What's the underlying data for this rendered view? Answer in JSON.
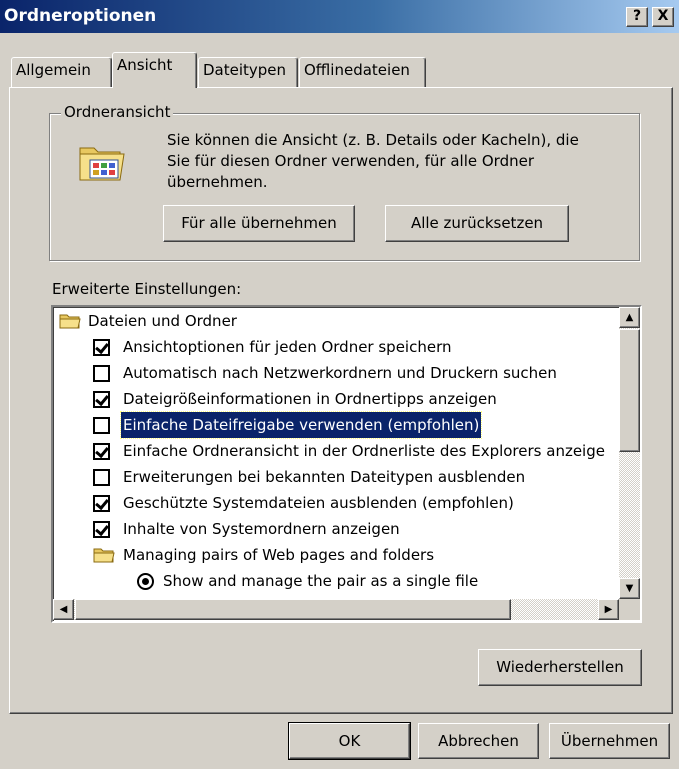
{
  "window": {
    "title": "Ordneroptionen",
    "help_label": "?",
    "close_label": "X"
  },
  "tabs": [
    {
      "label": "Allgemein",
      "active": false
    },
    {
      "label": "Ansicht",
      "active": true
    },
    {
      "label": "Dateitypen",
      "active": false
    },
    {
      "label": "Offlinedateien",
      "active": false
    }
  ],
  "folder_view": {
    "group_title": "Ordneransicht",
    "description": "Sie können die Ansicht (z. B. Details oder Kacheln), die Sie für diesen Ordner verwenden, für alle Ordner übernehmen.",
    "apply_all_label": "Für alle übernehmen",
    "reset_all_label": "Alle zurücksetzen"
  },
  "advanced": {
    "label": "Erweiterte Einstellungen:",
    "items": [
      {
        "type": "folder",
        "label": "Dateien und Ordner"
      },
      {
        "type": "checkbox",
        "checked": true,
        "label": "Ansichtoptionen für jeden Ordner speichern"
      },
      {
        "type": "checkbox",
        "checked": false,
        "label": "Automatisch nach Netzwerkordnern und Druckern suchen"
      },
      {
        "type": "checkbox",
        "checked": true,
        "label": "Dateigrößeinformationen in Ordnertipps anzeigen"
      },
      {
        "type": "checkbox",
        "checked": false,
        "label": "Einfache Dateifreigabe verwenden (empfohlen)",
        "selected": true
      },
      {
        "type": "checkbox",
        "checked": true,
        "label": "Einfache Ordneransicht in der Ordnerliste des Explorers anzeige"
      },
      {
        "type": "checkbox",
        "checked": false,
        "label": "Erweiterungen bei bekannten Dateitypen ausblenden"
      },
      {
        "type": "checkbox",
        "checked": true,
        "label": "Geschützte Systemdateien ausblenden (empfohlen)"
      },
      {
        "type": "checkbox",
        "checked": true,
        "label": "Inhalte von Systemordnern anzeigen"
      },
      {
        "type": "folder",
        "label": "Managing pairs of Web pages and folders"
      },
      {
        "type": "radio",
        "checked": true,
        "label": "Show and manage the pair as a single file"
      }
    ],
    "restore_label": "Wiederherstellen"
  },
  "footer": {
    "ok_label": "OK",
    "cancel_label": "Abbrechen",
    "apply_label": "Übernehmen"
  },
  "colors": {
    "face": "#d4d0c8",
    "title_start": "#0a246a",
    "title_end": "#a6caf0",
    "selection": "#0a246a"
  }
}
